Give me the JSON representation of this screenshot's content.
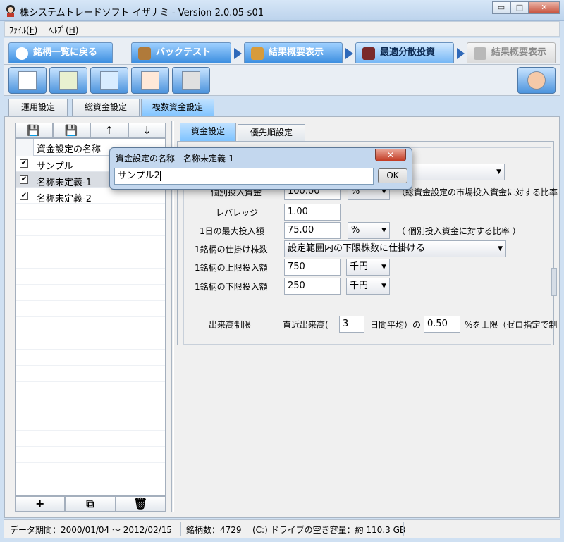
{
  "window": {
    "title": "株システムトレードソフト イザナミ - Version 2.0.05-s01",
    "minimize": "▭",
    "maximize": "□",
    "close": "✕"
  },
  "menu": [
    {
      "label": "ﾌｧｲﾙ(",
      "key": "F",
      "end": ")"
    },
    {
      "label": "ﾍﾙﾌﾟ(",
      "key": "H",
      "end": ")"
    }
  ],
  "nav": {
    "back": "銘柄一覧に戻る",
    "backtest": "バックテスト",
    "summary1": "結果概要表示",
    "optimize": "最適分散投資",
    "summary2": "結果概要表示"
  },
  "toolbar": {
    "icons": [
      "new-document-icon",
      "currency-icon",
      "export-icon",
      "import-icon",
      "tools-icon",
      "exit-icon"
    ]
  },
  "main_tabs": [
    "運用設定",
    "総資金設定",
    "複数資金設定"
  ],
  "left_panel": {
    "toolbar_icons": [
      "save-icon",
      "save-as-icon",
      "arrow-up-icon",
      "arrow-down-icon"
    ],
    "header": "資金設定の名称",
    "rows": [
      {
        "checked": "☑",
        "name": "サンプル"
      },
      {
        "checked": "☑",
        "name": "名称未定義-1"
      },
      {
        "checked": "☑",
        "name": "名称未定義-2"
      }
    ],
    "bottom": {
      "add": "+",
      "copy": "⧉",
      "delete": "🗑"
    }
  },
  "sub_tabs": [
    "資金設定",
    "優先順設定"
  ],
  "form": {
    "row0_partial": "個別投入資金",
    "row0_value": "100.00",
    "row0_unit": "%",
    "row0_note": "（総資金設定の市場投入資金に対する比率",
    "leverage_label": "レバレッジ",
    "leverage_value": "1.00",
    "daily_max_label": "1日の最大投入額",
    "daily_max_value": "75.00",
    "daily_max_unit": "%",
    "daily_max_note": "（ 個別投入資金に対する比率 ）",
    "order_shares_label": "1銘柄の仕掛け株数",
    "order_shares_value": "設定範囲内の下限株数に仕掛ける",
    "upper_label": "1銘柄の上限投入額",
    "upper_value": "750",
    "upper_unit": "千円",
    "lower_label": "1銘柄の下限投入額",
    "lower_value": "250",
    "lower_unit": "千円",
    "volume_label": "出来高制限",
    "volume_text1": "直近出来高(",
    "volume_days": "3",
    "volume_text2": "日間平均）の",
    "volume_ratio": "0.50",
    "volume_text3": "%を上限（ゼロ指定で制"
  },
  "status": {
    "period": "データ期間：2000/01/04 〜 2012/02/15",
    "count": "銘柄数：4729",
    "disk": "(C:) ドライブの空き容量：約 110.3 GB"
  },
  "dialog": {
    "title": "資金設定の名称 - 名称未定義-1",
    "close": "✕",
    "value": "サンプル2",
    "ok": "OK"
  }
}
